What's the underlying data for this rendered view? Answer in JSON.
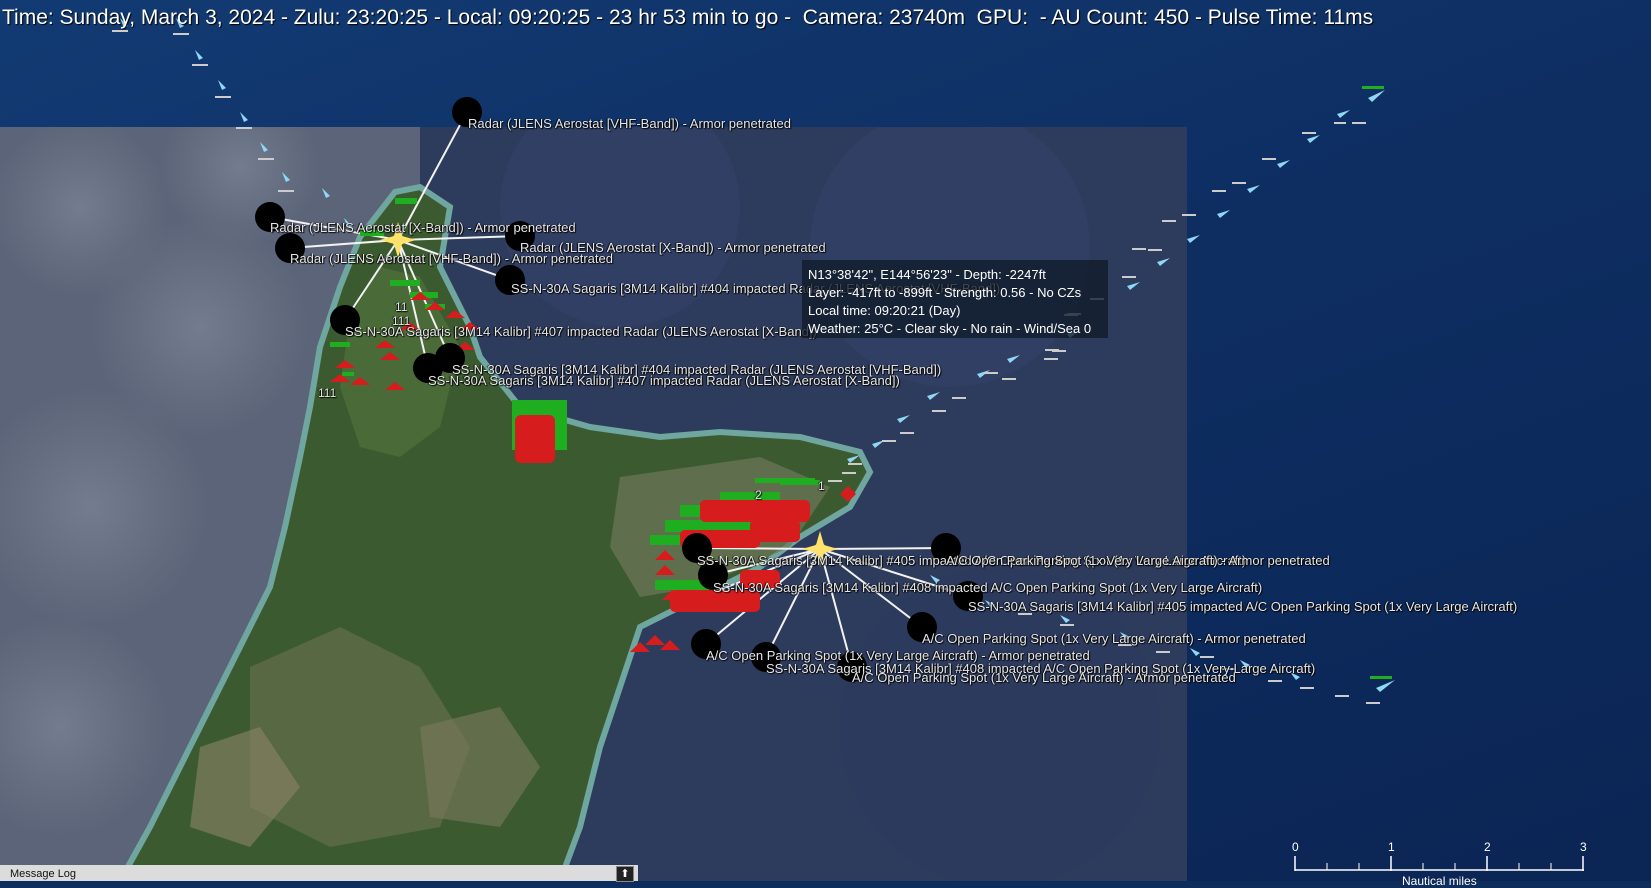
{
  "status_bar": {
    "text": "Time: Sunday, March 3, 2024 - Zulu: 23:20:25 - Local: 09:20:25 - 23 hr 53 min to go -  Camera: 23740m  GPU:  - AU Count: 450 - Pulse Time: 11ms"
  },
  "tooltip": {
    "line1": "N13°38'42\", E144°56'23\" - Depth: -2247ft",
    "line2": "Layer: -417ft to -899ft - Strength: 0.56 - No CZs",
    "line3": "Local time: 09:20:21 (Day)",
    "line4": "Weather: 25°C - Clear sky - No rain - Wind/Sea 0"
  },
  "map_labels": {
    "l01": "Radar (JLENS Aerostat [VHF-Band]) - Armor penetrated",
    "l02": "Radar (JLENS Aerostat [X-Band]) - Armor penetrated",
    "l03": "Radar (JLENS Aerostat [X-Band]) - Armor penetrated",
    "l04": "Radar (JLENS Aerostat [VHF-Band]) - Armor penetrated",
    "l05": "SS-N-30A Sagaris [3M14 Kalibr] #404 impacted Radar (JLENS Aerostat [VHF-Band])",
    "l06": "SS-N-30A Sagaris [3M14 Kalibr] #407 impacted Radar (JLENS Aerostat [X-Band])",
    "l07": "SS-N-30A Sagaris [3M14 Kalibr] #404 impacted Radar (JLENS Aerostat [VHF-Band])",
    "l08": "SS-N-30A Sagaris [3M14 Kalibr] #407 impacted Radar (JLENS Aerostat [X-Band])",
    "l09": "SS-N-30A Sagaris [3M14 Kalibr] #405 impacted A/C Open Parking Spot (1x Very Large Aircraft)",
    "l10": "A/C Open Parking Spot (1x Very Large Aircraft) - Armor penetrated",
    "l11": "SS-N-30A Sagaris [3M14 Kalibr] #408 impacted A/C Open Parking Spot (1x Very Large Aircraft)",
    "l12": "SS-N-30A Sagaris [3M14 Kalibr] #405 impacted A/C Open Parking Spot (1x Very Large Aircraft)",
    "l13": "A/C Open Parking Spot (1x Very Large Aircraft) - Armor penetrated",
    "l14": "A/C Open Parking Spot (1x Very Large Aircraft) - Armor penetrated",
    "l15": "SS-N-30A Sagaris [3M14 Kalibr] #408 impacted A/C Open Parking Spot (1x Very Large Aircraft)",
    "l16": "A/C Open Parking Spot (1x Very Large Aircraft) - Armor penetrated"
  },
  "unit_badges": {
    "b1": "1",
    "b2": "2",
    "b3": "11",
    "b4": "111",
    "b5": "111"
  },
  "message_log": {
    "label": "Message Log",
    "toggle_icon": "up-arrow-icon"
  },
  "scale_bar": {
    "ticks": [
      "0",
      "1",
      "2",
      "3"
    ],
    "unit": "Nautical miles"
  },
  "colors": {
    "ocean": "#0e2e62",
    "hostile_red": "#d61c1c",
    "friendly_green": "#1fae1f",
    "missile_cyan": "#8fd8f5",
    "impact_black": "#000000"
  }
}
